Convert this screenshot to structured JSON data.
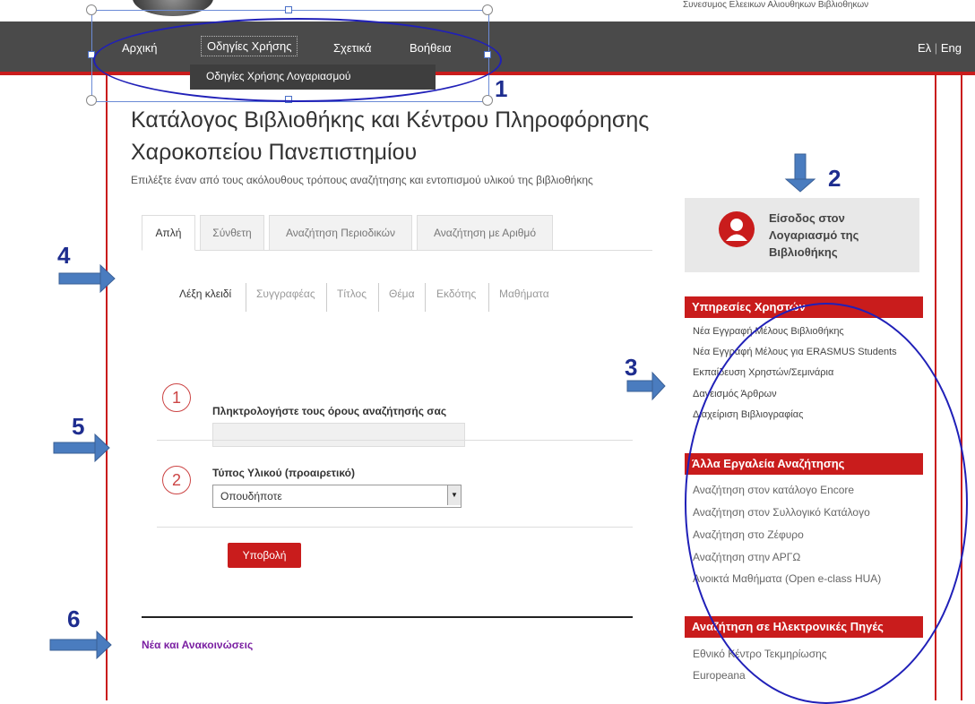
{
  "header": {
    "org_name": "Συνεσυμος Ελεεικων Αλιουθηκων Βιβλιοθηκων"
  },
  "nav": {
    "items": [
      {
        "label": "Αρχική"
      },
      {
        "label": "Οδηγίες Χρήσης"
      },
      {
        "label": "Σχετικά"
      },
      {
        "label": "Βοήθεια"
      }
    ],
    "dropdown_item": "Οδηγίες Χρήσης Λογαριασμού",
    "lang_el": "Ελ",
    "lang_sep": "|",
    "lang_en": "Eng"
  },
  "main": {
    "title": "Κατάλογος Βιβλιοθήκης και Κέντρου Πληροφόρησης Χαροκοπείου Πανεπιστημίου",
    "subtitle": "Επιλέξτε έναν από τους ακόλουθους τρόπους αναζήτησης και εντοπισμού υλικού της βιβλιοθήκης",
    "tabs": [
      {
        "label": "Απλή"
      },
      {
        "label": "Σύνθετη"
      },
      {
        "label": "Αναζήτηση Περιοδικών"
      },
      {
        "label": "Αναζήτηση με Αριθμό"
      }
    ],
    "subtabs": [
      {
        "label": "Λέξη κλειδί"
      },
      {
        "label": "Συγγραφέας"
      },
      {
        "label": "Τίτλος"
      },
      {
        "label": "Θέμα"
      },
      {
        "label": "Εκδότης"
      },
      {
        "label": "Μαθήματα"
      }
    ],
    "step1_num": "1",
    "step1_label": "Πληκτρολογήστε τους όρους αναζήτησής σας",
    "step2_num": "2",
    "step2_label": "Τύπος Υλικού (προαιρετικό)",
    "material_type_value": "Οπουδήποτε",
    "select_arrow": "▼",
    "submit_label": "Υποβολή",
    "news_label": "Νέα και Ανακοινώσεις"
  },
  "sidebar": {
    "login_label": "Είσοδος στον Λογαριασμό της Βιβλιοθήκης",
    "user_services_title": "Υπηρεσίες Χρηστών",
    "user_services": [
      "Νέα Εγγραφή Μέλους Βιβλιοθήκης",
      "Νέα Εγγραφή Μέλους για ERASMUS Students",
      "Εκπαίδευση Χρηστών/Σεμινάρια",
      "Δανεισμός Άρθρων",
      "Διαχείριση Βιβλιογραφίας"
    ],
    "other_tools_title": "Άλλα Εργαλεία Αναζήτησης",
    "other_tools": [
      "Αναζήτηση στον κατάλογο Encore",
      "Αναζήτηση στον Συλλογικό Κατάλογο",
      "Αναζήτηση στο Ζέφυρο",
      "Αναζήτηση στην ΑΡΓΩ",
      "Ανοικτά Μαθήματα (Open e-class HUA)"
    ],
    "e_sources_title": "Αναζήτηση σε Ηλεκτρονικές Πηγές",
    "e_sources": [
      "Εθνικό Κέντρο Τεκμηρίωσης",
      "Europeana"
    ]
  },
  "annotations": [
    "1",
    "2",
    "3",
    "4",
    "5",
    "6"
  ],
  "colors": {
    "accent_red": "#c91c1c",
    "nav_bg": "#4a4a4a",
    "annotation_blue": "#2020b8",
    "arrow_blue": "#4a7cbf",
    "news_purple": "#7a1fa2"
  }
}
